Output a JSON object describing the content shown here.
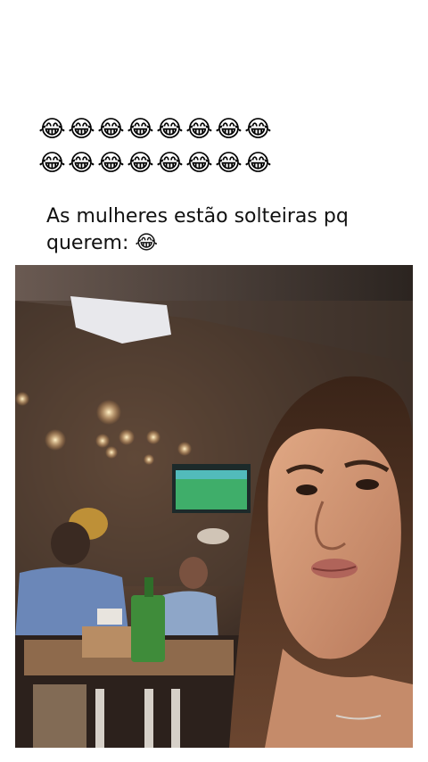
{
  "emoji_rows": [
    [
      "😂",
      "😂",
      "😂",
      "😂",
      "😂",
      "😂",
      "😂",
      "😂"
    ],
    [
      "😂",
      "😂",
      "😂",
      "😂",
      "😂",
      "😂",
      "😂",
      "😂"
    ]
  ],
  "caption": "As mulheres estão solteiras pq querem: 😂",
  "colors": {
    "background": "#ffffff",
    "caption_text": "#111111"
  }
}
